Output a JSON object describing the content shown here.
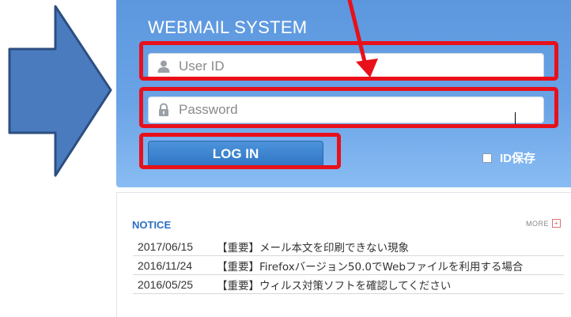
{
  "login": {
    "title": "WEBMAIL SYSTEM",
    "userid_placeholder": "User ID",
    "password_placeholder": "Password",
    "login_button": "LOG IN",
    "remember_label": "ID保存"
  },
  "notice": {
    "title": "NOTICE",
    "more_label": "MORE",
    "items": [
      {
        "date": "2017/06/15",
        "subject": "【重要】メール本文を印刷できない現象"
      },
      {
        "date": "2016/11/24",
        "subject": "【重要】Firefoxバージョン50.0でWebファイルを利用する場合"
      },
      {
        "date": "2016/05/25",
        "subject": "【重要】ウィルス対策ソフトを確認してください"
      }
    ]
  },
  "colors": {
    "panel_blue": "#6aa3e6",
    "button_blue": "#2f75c4",
    "annotation_red": "#e8101a",
    "notice_blue": "#2e6fc2",
    "arrow_blue": "#4b7bbf"
  },
  "icons": {
    "userid": "user-icon",
    "password": "lock-icon",
    "more": "plus-icon"
  }
}
